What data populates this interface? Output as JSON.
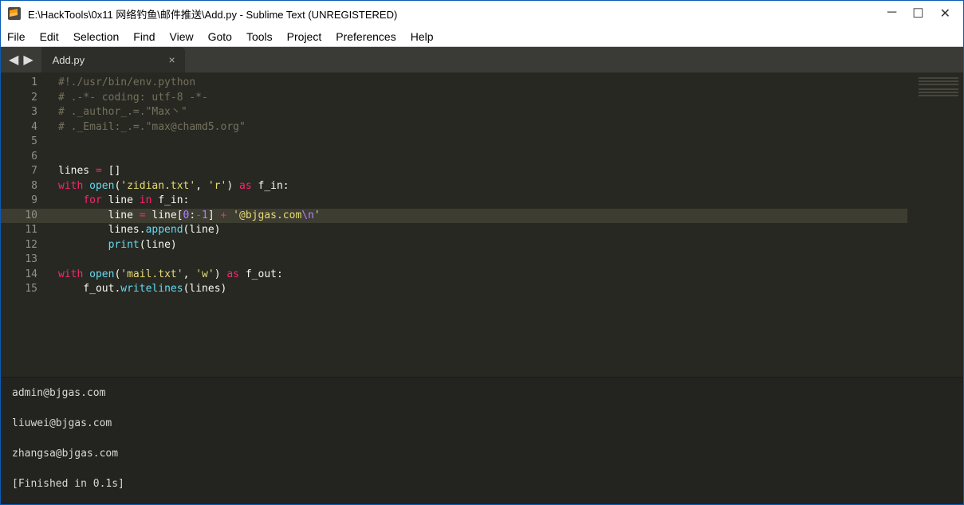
{
  "window": {
    "title": "E:\\HackTools\\0x11 网络钓鱼\\邮件推送\\Add.py - Sublime Text (UNREGISTERED)"
  },
  "menu": {
    "file": "File",
    "edit": "Edit",
    "selection": "Selection",
    "find": "Find",
    "view": "View",
    "goto": "Goto",
    "tools": "Tools",
    "project": "Project",
    "preferences": "Preferences",
    "help": "Help"
  },
  "tab": {
    "label": "Add.py"
  },
  "gutter": {
    "lines": [
      "1",
      "2",
      "3",
      "4",
      "5",
      "6",
      "7",
      "8",
      "9",
      "10",
      "11",
      "12",
      "13",
      "14",
      "15"
    ],
    "current_line": 10
  },
  "code": {
    "lines": [
      [
        {
          "cls": "c-comment",
          "t": "#!./usr/bin/env.python"
        }
      ],
      [
        {
          "cls": "c-comment",
          "t": "# .-*- coding: utf-8 -*-"
        }
      ],
      [
        {
          "cls": "c-comment",
          "t": "# ._author_.=.\"Max丶\""
        }
      ],
      [
        {
          "cls": "c-comment",
          "t": "# ._Email:_.=.\"max@chamd5.org\""
        }
      ],
      [],
      [],
      [
        {
          "cls": "c-default",
          "t": "lines "
        },
        {
          "cls": "c-keyword",
          "t": "="
        },
        {
          "cls": "c-default",
          "t": " []"
        }
      ],
      [
        {
          "cls": "c-keyword",
          "t": "with"
        },
        {
          "cls": "c-default",
          "t": " "
        },
        {
          "cls": "c-builtin",
          "t": "open"
        },
        {
          "cls": "c-default",
          "t": "("
        },
        {
          "cls": "c-string",
          "t": "'zidian.txt'"
        },
        {
          "cls": "c-default",
          "t": ", "
        },
        {
          "cls": "c-string",
          "t": "'r'"
        },
        {
          "cls": "c-default",
          "t": ") "
        },
        {
          "cls": "c-keyword",
          "t": "as"
        },
        {
          "cls": "c-default",
          "t": " f_in:"
        }
      ],
      [
        {
          "cls": "c-default",
          "t": "    "
        },
        {
          "cls": "c-keyword",
          "t": "for"
        },
        {
          "cls": "c-default",
          "t": " line "
        },
        {
          "cls": "c-keyword",
          "t": "in"
        },
        {
          "cls": "c-default",
          "t": " f_in:"
        }
      ],
      [
        {
          "cls": "c-default",
          "t": "        line "
        },
        {
          "cls": "c-keyword",
          "t": "="
        },
        {
          "cls": "c-default",
          "t": " line["
        },
        {
          "cls": "c-number",
          "t": "0"
        },
        {
          "cls": "c-default",
          "t": ":"
        },
        {
          "cls": "c-keyword",
          "t": "-"
        },
        {
          "cls": "c-number",
          "t": "1"
        },
        {
          "cls": "c-default",
          "t": "] "
        },
        {
          "cls": "c-keyword",
          "t": "+"
        },
        {
          "cls": "c-default",
          "t": " "
        },
        {
          "cls": "c-string",
          "t": "'@bjgas.com"
        },
        {
          "cls": "c-escape",
          "t": "\\n"
        },
        {
          "cls": "c-string",
          "t": "'"
        }
      ],
      [
        {
          "cls": "c-default",
          "t": "        lines."
        },
        {
          "cls": "c-builtin",
          "t": "append"
        },
        {
          "cls": "c-default",
          "t": "(line)"
        }
      ],
      [
        {
          "cls": "c-default",
          "t": "        "
        },
        {
          "cls": "c-builtin",
          "t": "print"
        },
        {
          "cls": "c-default",
          "t": "(line)"
        }
      ],
      [],
      [
        {
          "cls": "c-keyword",
          "t": "with"
        },
        {
          "cls": "c-default",
          "t": " "
        },
        {
          "cls": "c-builtin",
          "t": "open"
        },
        {
          "cls": "c-default",
          "t": "("
        },
        {
          "cls": "c-string",
          "t": "'mail.txt'"
        },
        {
          "cls": "c-default",
          "t": ", "
        },
        {
          "cls": "c-string",
          "t": "'w'"
        },
        {
          "cls": "c-default",
          "t": ") "
        },
        {
          "cls": "c-keyword",
          "t": "as"
        },
        {
          "cls": "c-default",
          "t": " f_out:"
        }
      ],
      [
        {
          "cls": "c-default",
          "t": "    f_out."
        },
        {
          "cls": "c-builtin",
          "t": "writelines"
        },
        {
          "cls": "c-default",
          "t": "(lines)"
        }
      ]
    ]
  },
  "console": {
    "output": "admin@bjgas.com\n\nliuwei@bjgas.com\n\nzhangsa@bjgas.com\n\n[Finished in 0.1s]"
  }
}
